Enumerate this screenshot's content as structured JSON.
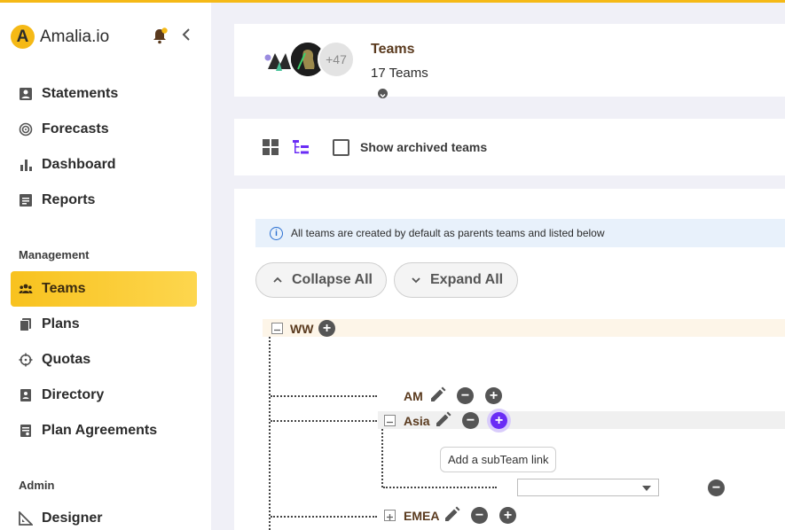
{
  "brand": {
    "logo_letter": "A",
    "name": "Amalia.io",
    "accent": "#f5b916"
  },
  "sidebar": {
    "items": [
      {
        "label": "Statements",
        "icon": "statements-icon"
      },
      {
        "label": "Forecasts",
        "icon": "forecasts-icon"
      },
      {
        "label": "Dashboard",
        "icon": "dashboard-icon"
      },
      {
        "label": "Reports",
        "icon": "reports-icon"
      }
    ],
    "management_title": "Management",
    "management_items": [
      {
        "label": "Teams",
        "icon": "teams-icon",
        "active": true
      },
      {
        "label": "Plans",
        "icon": "plans-icon"
      },
      {
        "label": "Quotas",
        "icon": "quotas-icon"
      },
      {
        "label": "Directory",
        "icon": "directory-icon"
      },
      {
        "label": "Plan Agreements",
        "icon": "plan-agreements-icon"
      }
    ],
    "admin_title": "Admin",
    "admin_items": [
      {
        "label": "Designer",
        "icon": "designer-icon"
      }
    ]
  },
  "header": {
    "title": "Teams",
    "subtitle": "17 Teams",
    "avatar_more": "+47"
  },
  "toolbar": {
    "show_archived_label": "Show archived teams"
  },
  "main": {
    "info_text": "All teams are created by default as parents teams and listed below",
    "collapse_all": "Collapse All",
    "expand_all": "Expand All",
    "tooltip": "Add a subTeam link"
  },
  "tree": {
    "ww": "WW",
    "am": "AM",
    "asia": "Asia",
    "emea": "EMEA"
  },
  "colors": {
    "active_nav": "#f8c21e",
    "link_purple": "#6a2cf5",
    "info_bg": "#e8f1fb",
    "team_label": "#5a3a1e"
  }
}
